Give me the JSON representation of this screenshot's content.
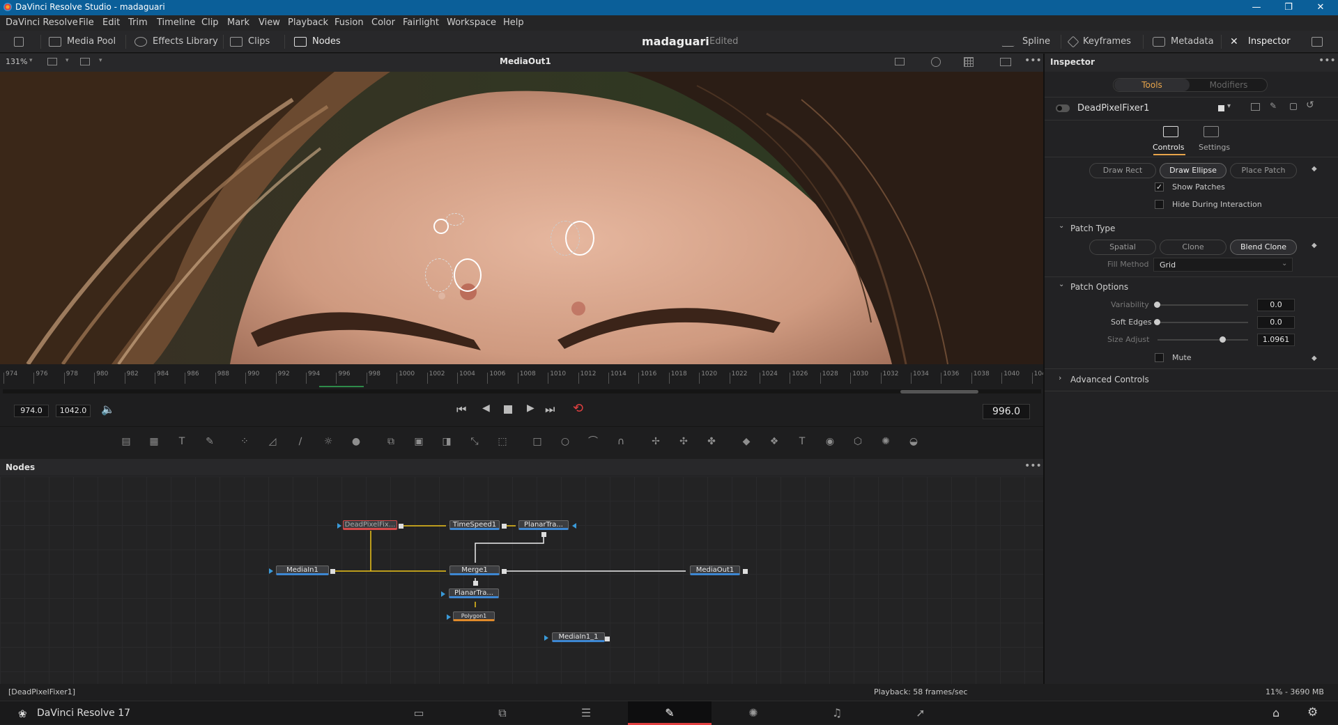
{
  "window": {
    "title": "DaVinci Resolve Studio - madaguari",
    "min": "—",
    "max": "❐",
    "close": "✕"
  },
  "menu": [
    "DaVinci Resolve",
    "File",
    "Edit",
    "Trim",
    "Timeline",
    "Clip",
    "Mark",
    "View",
    "Playback",
    "Fusion",
    "Color",
    "Fairlight",
    "Workspace",
    "Help"
  ],
  "toolbar": {
    "media_pool": "Media Pool",
    "effects": "Effects Library",
    "clips": "Clips",
    "nodes": "Nodes",
    "project": "madaguari",
    "edited": "Edited",
    "spline": "Spline",
    "keyframes": "Keyframes",
    "metadata": "Metadata",
    "inspector": "Inspector"
  },
  "viewer": {
    "zoom": "131%",
    "title": "MediaOut1"
  },
  "ruler": {
    "ticks": [
      "974",
      "976",
      "978",
      "980",
      "982",
      "984",
      "986",
      "988",
      "990",
      "992",
      "994",
      "996",
      "998",
      "1000",
      "1002",
      "1004",
      "1006",
      "1008",
      "1010",
      "1012",
      "1014",
      "1016",
      "1018",
      "1020",
      "1022",
      "1024",
      "1026",
      "1028",
      "1030",
      "1032",
      "1034",
      "1036",
      "1038",
      "1040",
      "104"
    ]
  },
  "transport": {
    "start": "974.0",
    "end": "1042.0",
    "current": "996.0"
  },
  "nodes": {
    "title": "Nodes",
    "items": {
      "dpf": "DeadPixelFix...",
      "ts": "TimeSpeed1",
      "pt1": "PlanarTra...",
      "mi": "MediaIn1",
      "mg": "Merge1",
      "mo": "MediaOut1",
      "pt2": "PlanarTra...",
      "poly": "Polygon1",
      "mi2": "MediaIn1_1"
    }
  },
  "status": {
    "left": "[DeadPixelFixer1]",
    "center": "Playback: 58 frames/sec",
    "right": "11% - 3690 MB"
  },
  "app": {
    "name": "DaVinci Resolve 17"
  },
  "inspector": {
    "title": "Inspector",
    "tab_tools": "Tools",
    "tab_modifiers": "Modifiers",
    "tool_name": "DeadPixelFixer1",
    "controls": "Controls",
    "settings": "Settings",
    "draw_rect": "Draw Rect",
    "draw_ellipse": "Draw Ellipse",
    "place_patch": "Place Patch",
    "show_patches": "Show Patches",
    "hide_during": "Hide During Interaction",
    "patch_type": "Patch Type",
    "spatial": "Spatial",
    "clone": "Clone",
    "blend_clone": "Blend Clone",
    "fill_method_label": "Fill Method",
    "fill_method": "Grid",
    "patch_options": "Patch Options",
    "variability_label": "Variability",
    "variability": "0.0",
    "soft_edges_label": "Soft Edges",
    "soft_edges": "0.0",
    "size_adjust_label": "Size Adjust",
    "size_adjust": "1.0961",
    "mute": "Mute",
    "advanced": "Advanced Controls"
  }
}
